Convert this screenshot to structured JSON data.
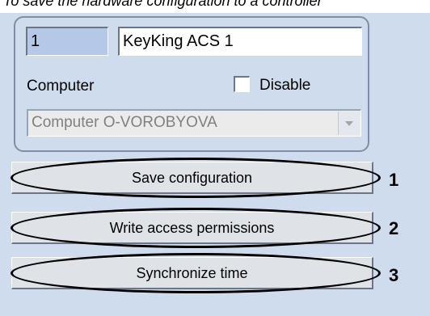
{
  "caption": "To save the hardware configuration to a controller",
  "form": {
    "id_value": "1",
    "name_value": "KeyKing ACS 1",
    "computer_label": "Computer",
    "disable_label": "Disable",
    "disable_checked": false,
    "computer_selected": "Computer O-VOROBYOVA"
  },
  "buttons": [
    {
      "label": "Save configuration",
      "callout": "1"
    },
    {
      "label": "Write access permissions",
      "callout": "2"
    },
    {
      "label": "Synchronize time",
      "callout": "3"
    }
  ],
  "icons": {
    "dropdown": "chevron-down-icon"
  }
}
